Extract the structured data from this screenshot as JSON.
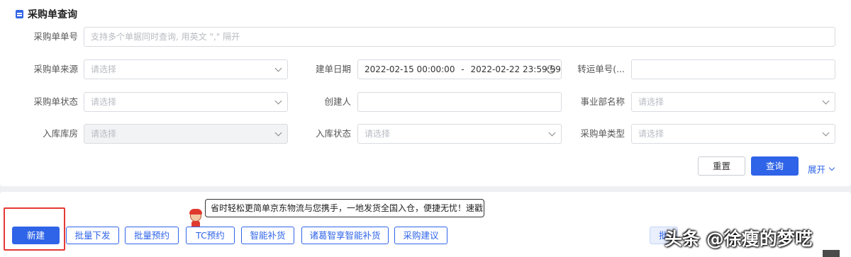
{
  "panel": {
    "title": "采购单查询"
  },
  "form": {
    "po_number": {
      "label": "采购单单号",
      "placeholder": "支持多个单据同时查询, 用英文 \",\" 隔开"
    },
    "po_source": {
      "label": "采购单来源",
      "placeholder": "请选择"
    },
    "created_date": {
      "label": "建单日期",
      "start": "2022-02-15 00:00:00",
      "separator": "-",
      "end": "2022-02-22 23:59:59"
    },
    "transfer_no": {
      "label": "转运单号(...",
      "value": ""
    },
    "po_status": {
      "label": "采购单状态",
      "placeholder": "请选择"
    },
    "creator": {
      "label": "创建人",
      "value": ""
    },
    "division": {
      "label": "事业部名称",
      "placeholder": "请选择"
    },
    "warehouse": {
      "label": "入库库房",
      "placeholder": "请选择"
    },
    "inbound_status": {
      "label": "入库状态",
      "placeholder": "请选择"
    },
    "po_type": {
      "label": "采购单类型",
      "placeholder": "请选择"
    }
  },
  "actions": {
    "reset": "重置",
    "query": "查询",
    "expand": "展开"
  },
  "toolbar": {
    "buttons": [
      "新建",
      "批量下发",
      "批量预约",
      "TC预约",
      "智能补货",
      "诸葛智享智能补货",
      "采购建议"
    ],
    "partial_button": "批"
  },
  "tooltip": "省时轻松更简单京东物流与您携手，一地发货全国入仓，便捷无忧！速戳",
  "watermark": "头条 @徐瘦的梦呓",
  "colors": {
    "primary": "#2f64e8",
    "highlight": "#e53935",
    "mascot": "#e03a2f"
  }
}
